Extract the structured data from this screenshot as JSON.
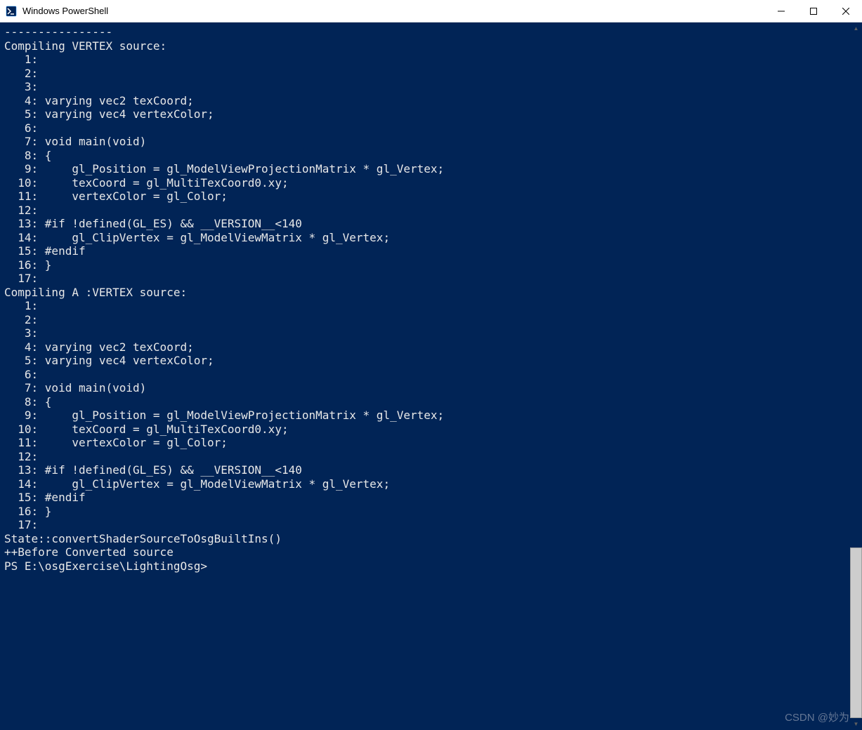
{
  "window": {
    "title": "Windows PowerShell"
  },
  "terminal": {
    "divider": "----------------",
    "block1_header": "Compiling VERTEX source:",
    "block2_header": "Compiling A :VERTEX source:",
    "shader_lines": [
      {
        "n": "1",
        "t": ""
      },
      {
        "n": "2",
        "t": ""
      },
      {
        "n": "3",
        "t": ""
      },
      {
        "n": "4",
        "t": "varying vec2 texCoord;"
      },
      {
        "n": "5",
        "t": "varying vec4 vertexColor;"
      },
      {
        "n": "6",
        "t": ""
      },
      {
        "n": "7",
        "t": "void main(void)"
      },
      {
        "n": "8",
        "t": "{"
      },
      {
        "n": "9",
        "t": "    gl_Position = gl_ModelViewProjectionMatrix * gl_Vertex;"
      },
      {
        "n": "10",
        "t": "    texCoord = gl_MultiTexCoord0.xy;"
      },
      {
        "n": "11",
        "t": "    vertexColor = gl_Color;"
      },
      {
        "n": "12",
        "t": ""
      },
      {
        "n": "13",
        "t": "#if !defined(GL_ES) && __VERSION__<140"
      },
      {
        "n": "14",
        "t": "    gl_ClipVertex = gl_ModelViewMatrix * gl_Vertex;"
      },
      {
        "n": "15",
        "t": "#endif"
      },
      {
        "n": "16",
        "t": "}"
      },
      {
        "n": "17",
        "t": ""
      }
    ],
    "footer1": "State::convertShaderSourceToOsgBuiltIns()",
    "footer2": "++Before Converted source",
    "prompt": "PS E:\\osgExercise\\LightingOsg>"
  },
  "watermark": "CSDN @妙为"
}
